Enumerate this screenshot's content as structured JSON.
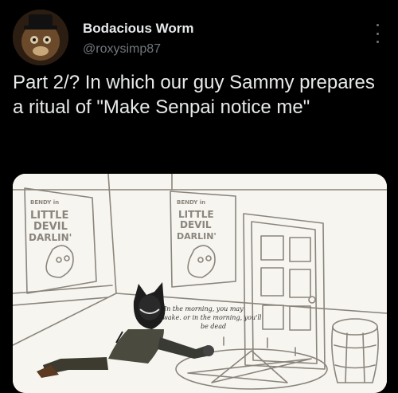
{
  "tweet": {
    "author_name": "Bodacious Worm",
    "author_handle": "@roxysimp87",
    "text": "Part 2/? In which our guy Sammy prepares a ritual of \"Make Senpai notice me\""
  },
  "icons": {
    "more": "more-options-icon",
    "avatar": "avatar-image"
  },
  "media": {
    "poster_left": {
      "line1": "BENDY in",
      "line2": "LITTLE",
      "line3": "DEVIL",
      "line4": "DARLIN'"
    },
    "poster_right": {
      "line1": "BENDY in",
      "line2": "LITTLE",
      "line3": "DEVIL",
      "line4": "DARLIN'"
    },
    "wall_writing": {
      "line1": "In the morning, you may",
      "line2": "wake. or in the morning, you'll",
      "line3": "be dead"
    }
  },
  "colors": {
    "background": "#000000",
    "text_primary": "#e7e9ea",
    "text_secondary": "#71767b",
    "paper": "#f7f5f0",
    "sketch": "#8a857c"
  }
}
